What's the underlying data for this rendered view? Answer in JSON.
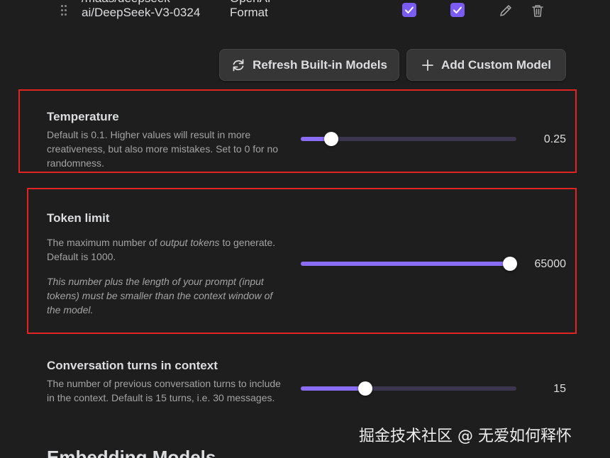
{
  "model_row": {
    "name_line1": "/maas/deepseek-",
    "name_line2": "ai/DeepSeek-V3-0324",
    "format_line1": "OpenAI",
    "format_line2": "Format",
    "enabled_checked": true,
    "secondary_checked": true
  },
  "buttons": {
    "refresh_label": "Refresh Built-in Models",
    "add_label": "Add Custom Model"
  },
  "temperature": {
    "title": "Temperature",
    "description": "Default is 0.1. Higher values will result in more creativeness, but also more mistakes. Set to 0 for no randomness.",
    "value": "0.25",
    "fraction": 0.14
  },
  "token_limit": {
    "title": "Token limit",
    "desc_prefix": "The maximum number of ",
    "desc_em": "output tokens",
    "desc_suffix": " to generate. Default is 1000.",
    "note": "This number plus the length of your prompt (input tokens) must be smaller than the context window of the model.",
    "value": "65000",
    "fraction": 0.97
  },
  "turns": {
    "title": "Conversation turns in context",
    "description": "The number of previous conversation turns to include in the context. Default is 15 turns, i.e. 30 messages.",
    "value": "15",
    "fraction": 0.3
  },
  "next_section": "Embedding Models",
  "watermark": "掘金技术社区 @ 无爱如何释怀",
  "colors": {
    "accent": "#8b6cf5",
    "checkbox": "#7b5cf2",
    "highlight": "#e02424",
    "background": "#1e1e1e"
  },
  "icons": [
    "drag-handle-icon",
    "check-icon",
    "pencil-icon",
    "trash-icon",
    "refresh-icon",
    "plus-icon"
  ]
}
